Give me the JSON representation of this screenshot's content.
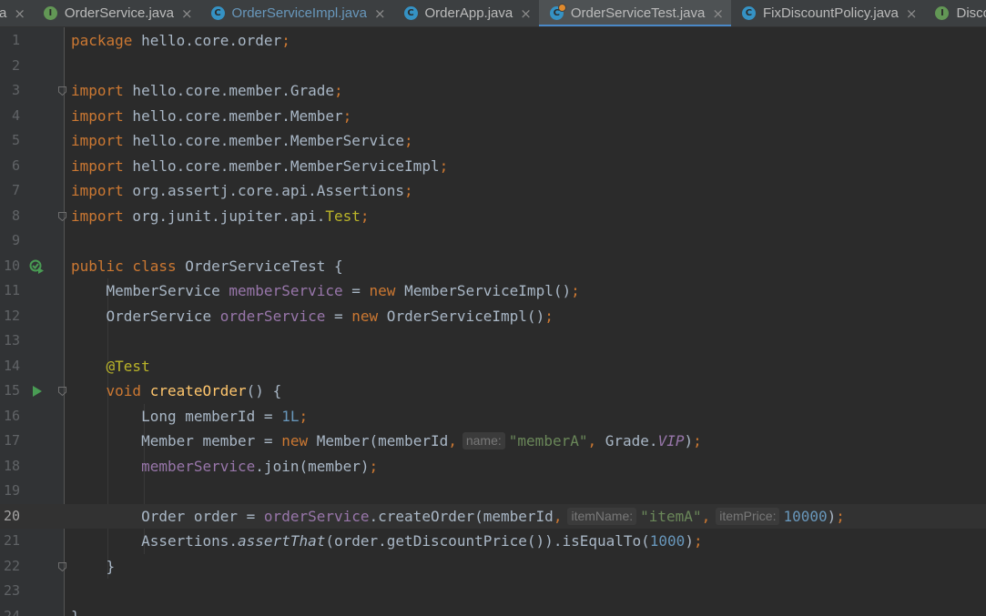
{
  "tabs": [
    {
      "label": "a",
      "icon": "none",
      "partial": true
    },
    {
      "label": "OrderService.java",
      "icon": "interface-icon",
      "icon_letter": "I"
    },
    {
      "label": "OrderServiceImpl.java",
      "icon": "class-icon",
      "icon_letter": "C",
      "modified": true
    },
    {
      "label": "OrderApp.java",
      "icon": "class-icon",
      "icon_letter": "C"
    },
    {
      "label": "OrderServiceTest.java",
      "icon": "test-class-icon",
      "icon_letter": "C",
      "active": true
    },
    {
      "label": "FixDiscountPolicy.java",
      "icon": "class-icon",
      "icon_letter": "C"
    },
    {
      "label": "Discou",
      "icon": "interface-icon",
      "icon_letter": "I",
      "partial": true
    }
  ],
  "tab_close_glyph": "×",
  "editor": {
    "current_line": 20,
    "colors": {
      "keyword": "#cc7832",
      "field": "#9876aa",
      "annotation": "#bbb529",
      "string": "#6a8759",
      "number": "#6897bb",
      "method": "#ffc66d",
      "text": "#a9b7c6"
    },
    "lines": [
      {
        "n": "1",
        "tokens": [
          [
            "kw",
            "package"
          ],
          [
            "t",
            " hello.core.order"
          ],
          [
            "kw",
            ";"
          ]
        ]
      },
      {
        "n": "2",
        "tokens": []
      },
      {
        "n": "3",
        "fold": true,
        "tokens": [
          [
            "kw",
            "import"
          ],
          [
            "t",
            " hello.core.member.Grade"
          ],
          [
            "kw",
            ";"
          ]
        ]
      },
      {
        "n": "4",
        "tokens": [
          [
            "kw",
            "import"
          ],
          [
            "t",
            " hello.core.member.Member"
          ],
          [
            "kw",
            ";"
          ]
        ]
      },
      {
        "n": "5",
        "tokens": [
          [
            "kw",
            "import"
          ],
          [
            "t",
            " hello.core.member.MemberService"
          ],
          [
            "kw",
            ";"
          ]
        ]
      },
      {
        "n": "6",
        "tokens": [
          [
            "kw",
            "import"
          ],
          [
            "t",
            " hello.core.member.MemberServiceImpl"
          ],
          [
            "kw",
            ";"
          ]
        ]
      },
      {
        "n": "7",
        "tokens": [
          [
            "kw",
            "import"
          ],
          [
            "t",
            " org.assertj.core.api.Assertions"
          ],
          [
            "kw",
            ";"
          ]
        ]
      },
      {
        "n": "8",
        "fold": true,
        "tokens": [
          [
            "kw",
            "import"
          ],
          [
            "t",
            " org.junit.jupiter.api."
          ],
          [
            "ann",
            "Test"
          ],
          [
            "kw",
            ";"
          ]
        ]
      },
      {
        "n": "9",
        "tokens": []
      },
      {
        "n": "10",
        "gicon": "run-test-class-icon",
        "tokens": [
          [
            "kw",
            "public class"
          ],
          [
            "t",
            " OrderServiceTest {"
          ]
        ]
      },
      {
        "n": "11",
        "tokens": [
          [
            "t",
            "    MemberService "
          ],
          [
            "fld",
            "memberService"
          ],
          [
            "t",
            " = "
          ],
          [
            "kw",
            "new"
          ],
          [
            "t",
            " MemberServiceImpl()"
          ],
          [
            "kw",
            ";"
          ]
        ]
      },
      {
        "n": "12",
        "tokens": [
          [
            "t",
            "    OrderService "
          ],
          [
            "fld",
            "orderService"
          ],
          [
            "t",
            " = "
          ],
          [
            "kw",
            "new"
          ],
          [
            "t",
            " OrderServiceImpl()"
          ],
          [
            "kw",
            ";"
          ]
        ]
      },
      {
        "n": "13",
        "tokens": []
      },
      {
        "n": "14",
        "tokens": [
          [
            "t",
            "    "
          ],
          [
            "ann",
            "@Test"
          ]
        ]
      },
      {
        "n": "15",
        "gicon": "run-test-icon",
        "fold": true,
        "tokens": [
          [
            "t",
            "    "
          ],
          [
            "kw",
            "void"
          ],
          [
            "t",
            " "
          ],
          [
            "fn",
            "createOrder"
          ],
          [
            "t",
            "() {"
          ]
        ]
      },
      {
        "n": "16",
        "tokens": [
          [
            "t",
            "        Long memberId = "
          ],
          [
            "num",
            "1L"
          ],
          [
            "kw",
            ";"
          ]
        ]
      },
      {
        "n": "17",
        "tokens": [
          [
            "t",
            "        Member member = "
          ],
          [
            "kw",
            "new"
          ],
          [
            "t",
            " Member(memberId"
          ],
          [
            "kw",
            ","
          ],
          [
            "hint",
            "name:"
          ],
          [
            "str",
            "\"memberA\""
          ],
          [
            "kw",
            ","
          ],
          [
            "t",
            " Grade."
          ],
          [
            "fldi",
            "VIP"
          ],
          [
            "t",
            ")"
          ],
          [
            "kw",
            ";"
          ]
        ]
      },
      {
        "n": "18",
        "tokens": [
          [
            "t",
            "        "
          ],
          [
            "fld",
            "memberService"
          ],
          [
            "t",
            ".join(member)"
          ],
          [
            "kw",
            ";"
          ]
        ]
      },
      {
        "n": "19",
        "tokens": []
      },
      {
        "n": "20",
        "tokens": [
          [
            "t",
            "        Order order = "
          ],
          [
            "fld",
            "orderService"
          ],
          [
            "t",
            ".createOrder(memberId"
          ],
          [
            "kw",
            ","
          ],
          [
            "hint",
            "itemName:"
          ],
          [
            "str",
            "\"itemA\""
          ],
          [
            "kw",
            ","
          ],
          [
            "hint",
            "itemPrice:"
          ],
          [
            "num",
            "10000"
          ],
          [
            "t",
            ")"
          ],
          [
            "kw",
            ";"
          ]
        ]
      },
      {
        "n": "21",
        "tokens": [
          [
            "t",
            "        Assertions."
          ],
          [
            "it",
            "assertThat"
          ],
          [
            "t",
            "(order.getDiscountPrice()).isEqualTo("
          ],
          [
            "num",
            "1000"
          ],
          [
            "t",
            ")"
          ],
          [
            "kw",
            ";"
          ]
        ]
      },
      {
        "n": "22",
        "fold": true,
        "tokens": [
          [
            "t",
            "    }"
          ]
        ]
      },
      {
        "n": "23",
        "tokens": []
      },
      {
        "n": "24",
        "tokens": [
          [
            "t",
            "}"
          ]
        ]
      }
    ]
  }
}
